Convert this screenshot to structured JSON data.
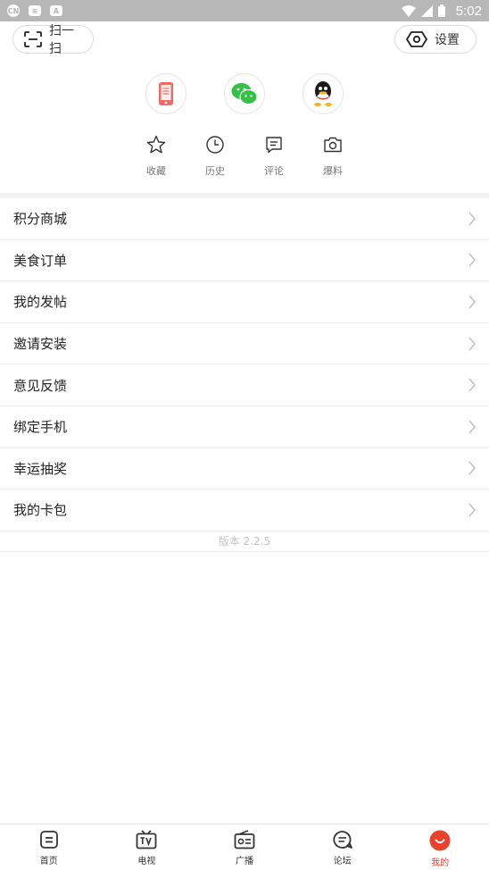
{
  "status_bar": {
    "left_icons": [
      "cn-icon",
      "message-icon",
      "a-icon"
    ],
    "right_icons": [
      "wifi-icon",
      "signal-icon",
      "battery-icon"
    ],
    "time": "5:02"
  },
  "top": {
    "scan_label": "扫一扫",
    "settings_label": "设置"
  },
  "login": {
    "items": [
      "phone-login-icon",
      "wechat-login-icon",
      "qq-login-icon"
    ]
  },
  "quick_actions": [
    {
      "label": "收藏",
      "icon": "star-icon"
    },
    {
      "label": "历史",
      "icon": "clock-icon"
    },
    {
      "label": "评论",
      "icon": "comment-icon"
    },
    {
      "label": "爆料",
      "icon": "camera-icon"
    }
  ],
  "menu": {
    "items": [
      {
        "label": "积分商城"
      },
      {
        "label": "美食订单"
      },
      {
        "label": "我的发帖"
      },
      {
        "label": "邀请安装"
      },
      {
        "label": "意见反馈"
      },
      {
        "label": "绑定手机"
      },
      {
        "label": "幸运抽奖"
      },
      {
        "label": "我的卡包"
      }
    ]
  },
  "version_text": "版本 2.2.5",
  "tabbar": {
    "items": [
      {
        "label": "首页",
        "icon": "home-icon"
      },
      {
        "label": "电视",
        "icon": "tv-icon"
      },
      {
        "label": "广播",
        "icon": "radio-icon"
      },
      {
        "label": "论坛",
        "icon": "forum-icon"
      },
      {
        "label": "我的",
        "icon": "me-icon",
        "active": true
      }
    ],
    "active_color": "#e8412c"
  }
}
